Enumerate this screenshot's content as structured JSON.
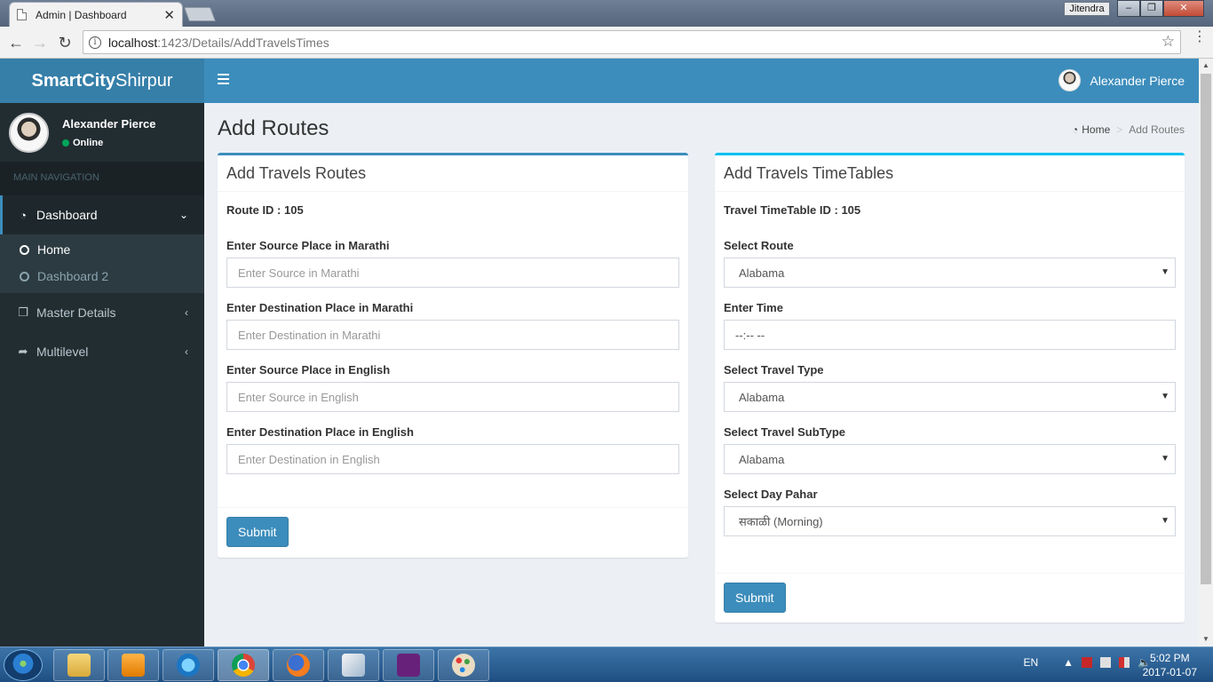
{
  "browser": {
    "tab_title": "Admin | Dashboard",
    "tab_close": "✕",
    "windows_user": "Jitendra",
    "url_host": "localhost",
    "url_rest": ":1423/Details/AddTravelsTimes"
  },
  "app": {
    "logo_bold": "SmartCity",
    "logo_light": "Shirpur",
    "top_user_name": "Alexander Pierce"
  },
  "sidebar": {
    "user_name": "Alexander Pierce",
    "user_status": "Online",
    "nav_header": "MAIN NAVIGATION",
    "items": [
      {
        "label": "Dashboard",
        "icon": "dashboard-icon"
      },
      {
        "label": "Master Details",
        "icon": "copy-icon"
      },
      {
        "label": "Multilevel",
        "icon": "share-icon"
      }
    ],
    "submenu": [
      {
        "label": "Home"
      },
      {
        "label": "Dashboard 2"
      }
    ]
  },
  "page": {
    "title": "Add Routes",
    "breadcrumb": [
      "Home",
      "Add Routes"
    ],
    "breadcrumb_sep": ">"
  },
  "routes_box": {
    "header": "Add Travels Routes",
    "id_line": "Route ID : 105",
    "fields": [
      {
        "label": "Enter Source Place in Marathi",
        "placeholder": "Enter Source in Marathi"
      },
      {
        "label": "Enter Destination Place in Marathi",
        "placeholder": "Enter Destination in Marathi"
      },
      {
        "label": "Enter Source Place in English",
        "placeholder": "Enter Source in English"
      },
      {
        "label": "Enter Destination Place in English",
        "placeholder": "Enter Destination in English"
      }
    ],
    "submit": "Submit"
  },
  "timetable_box": {
    "header": "Add Travels TimeTables",
    "id_line": "Travel TimeTable ID : 105",
    "route_label": "Select Route",
    "route_value": "Alabama",
    "time_label": "Enter Time",
    "time_value": "--:-- --",
    "type_label": "Select Travel Type",
    "type_value": "Alabama",
    "subtype_label": "Select Travel SubType",
    "subtype_value": "Alabama",
    "pahar_label": "Select Day Pahar",
    "pahar_value": "सकाळी (Morning)",
    "submit": "Submit"
  },
  "taskbar": {
    "lang": "EN",
    "time": "5:02 PM",
    "date": "2017-01-07"
  },
  "colors": {
    "primary": "#3c8dbc",
    "logo_bg": "#367fa9",
    "sidebar_bg": "#222d32",
    "info_border": "#00c0ef",
    "online": "#00a65a"
  }
}
